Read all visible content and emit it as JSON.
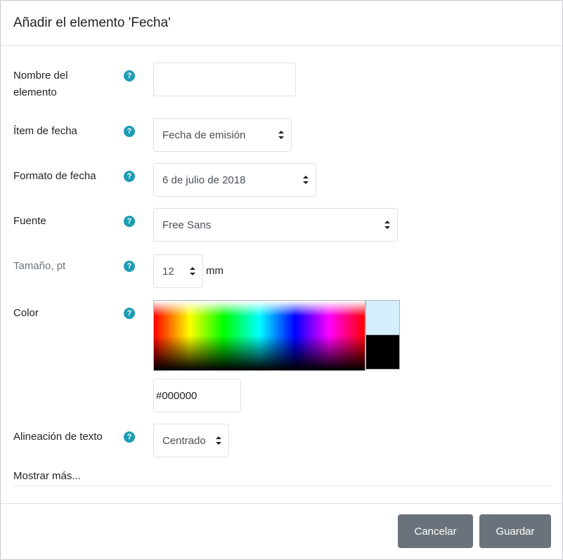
{
  "dialog": {
    "title": "Añadir el elemento 'Fecha'"
  },
  "fields": {
    "name": {
      "label_line1": "Nombre del",
      "label_line2": "elemento",
      "value": ""
    },
    "date_item": {
      "label": "Ítem de fecha",
      "value": "Fecha de emisión"
    },
    "date_format": {
      "label": "Formato de fecha",
      "value": "6 de julio de 2018"
    },
    "font": {
      "label": "Fuente",
      "value": "Free Sans"
    },
    "size": {
      "label": "Tamaño, pt",
      "value": "12",
      "unit": "mm"
    },
    "color": {
      "label": "Color",
      "value": "#000000",
      "preview_hover": "#d4eefb",
      "preview_selected": "#000000"
    },
    "alignment": {
      "label": "Alineación de texto",
      "value": "Centrado"
    }
  },
  "help_icon_glyph": "?",
  "show_more": "Mostrar más...",
  "buttons": {
    "cancel": "Cancelar",
    "save": "Guardar"
  },
  "colors": {
    "help_icon": "#1d9db4",
    "button_bg": "#6a737b"
  }
}
